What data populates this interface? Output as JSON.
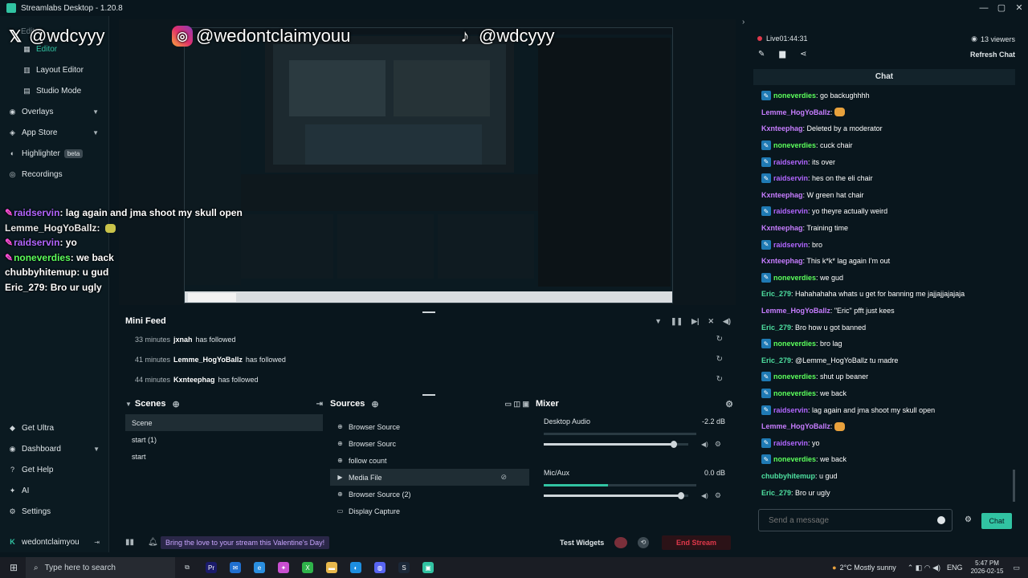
{
  "window": {
    "title": "Streamlabs Desktop - 1.20.8",
    "controls": [
      "—",
      "▢",
      "✕"
    ]
  },
  "sidebar": {
    "top_label": "Editor",
    "items": [
      {
        "label": "Editor",
        "icon": "editor-icon"
      },
      {
        "label": "Layout Editor",
        "icon": "layout-icon"
      },
      {
        "label": "Studio Mode",
        "icon": "studio-icon"
      },
      {
        "label": "Overlays",
        "icon": "overlays-icon",
        "chevron": true
      },
      {
        "label": "App Store",
        "icon": "app-store-icon",
        "chevron": true
      },
      {
        "label": "Highlighter",
        "icon": "highlighter-icon",
        "badge": "beta"
      },
      {
        "label": "Recordings",
        "icon": "recordings-icon"
      }
    ],
    "bottom_items": [
      {
        "label": "Get Ultra",
        "icon": "ultra-icon"
      },
      {
        "label": "Dashboard",
        "icon": "dashboard-icon",
        "chevron": true
      },
      {
        "label": "Get Help",
        "icon": "help-icon"
      },
      {
        "label": "AI",
        "icon": "ai-icon"
      },
      {
        "label": "Settings",
        "icon": "settings-icon"
      }
    ],
    "user": "wedontclaimyou"
  },
  "preview_overlay": {
    "x_handle": "@wdcyyy",
    "ig_handle": "@wedontclaimyouu",
    "tiktok_handle": "@wdcyyy",
    "chat_lines": [
      {
        "user": "raidservin",
        "text": ": lag again and jma shoot my skull open",
        "color": "#b266ff",
        "prime": true
      },
      {
        "user": "Lemme_HogYoBallz",
        "text": ": ",
        "color": "#e8e8e8",
        "emote": true
      },
      {
        "user": "raidservin",
        "text": ": yo",
        "color": "#b266ff",
        "prime": true
      },
      {
        "user": "noneverdies",
        "text": ": we back",
        "color": "#5cff5c",
        "prime": true
      },
      {
        "user": "chubbyhitemup",
        "text": ": u gud",
        "color": "#ffffff"
      },
      {
        "user": "Eric_279",
        "text": ": Bro ur ugly",
        "color": "#ffffff"
      }
    ]
  },
  "mini_feed": {
    "title": "Mini Feed",
    "rows": [
      {
        "time": "33 minutes",
        "name": "jxnah",
        "action": "has followed"
      },
      {
        "time": "41 minutes",
        "name": "Lemme_HogYoBallz",
        "action": "has followed"
      },
      {
        "time": "44 minutes",
        "name": "Kxnteephag",
        "action": "has followed"
      }
    ]
  },
  "scenes": {
    "title": "Scenes",
    "items": [
      "Scene",
      "start (1)",
      "start"
    ],
    "selected": 0
  },
  "sources": {
    "title": "Sources",
    "items": [
      {
        "label": "Browser Source",
        "icon": "globe-icon"
      },
      {
        "label": "Browser Sourc",
        "icon": "globe-icon"
      },
      {
        "label": "follow count",
        "icon": "globe-icon"
      },
      {
        "label": "Media File",
        "icon": "media-icon"
      },
      {
        "label": "Browser Source (2)",
        "icon": "globe-icon"
      },
      {
        "label": "Display Capture",
        "icon": "monitor-icon"
      }
    ],
    "selected": 3
  },
  "mixer": {
    "title": "Mixer",
    "tracks": [
      {
        "name": "Desktop Audio",
        "db": "-2.2 dB",
        "level": 0.9,
        "meter": 0.0
      },
      {
        "name": "Mic/Aux",
        "db": "0.0 dB",
        "level": 0.95,
        "meter": 0.42
      }
    ]
  },
  "bottom_bar": {
    "promo": "Bring the love to your stream this Valentine's Day!",
    "test_widgets": "Test Widgets",
    "end_stream": "End Stream"
  },
  "chat_panel": {
    "live_label": "Live",
    "live_time": "01:44:31",
    "viewers": "13 viewers",
    "refresh": "Refresh Chat",
    "title": "Chat",
    "input_placeholder": "Send a message",
    "send": "Chat",
    "messages": [
      {
        "user": "noneverdies",
        "text": ": go backughhhh",
        "color": "#5cff5c",
        "prime": true
      },
      {
        "user": "Lemme_HogYoBallz",
        "text": ": ",
        "color": "#c77dff",
        "emote": true
      },
      {
        "user": "Kxnteephag",
        "text": ": Deleted by a moderator",
        "color": "#c77dff"
      },
      {
        "user": "noneverdies",
        "text": ": cuck chair",
        "color": "#5cff5c",
        "prime": true
      },
      {
        "user": "raidservin",
        "text": ": its over",
        "color": "#b266ff",
        "prime": true
      },
      {
        "user": "raidservin",
        "text": ": hes on the eli chair",
        "color": "#b266ff",
        "prime": true
      },
      {
        "user": "Kxnteephag",
        "text": ": W green hat chair",
        "color": "#c77dff"
      },
      {
        "user": "raidservin",
        "text": ": yo theyre actually weird",
        "color": "#b266ff",
        "prime": true
      },
      {
        "user": "Kxnteephag",
        "text": ": Training time",
        "color": "#c77dff"
      },
      {
        "user": "raidservin",
        "text": ": bro",
        "color": "#b266ff",
        "prime": true
      },
      {
        "user": "Kxnteephag",
        "text": ": This k*k* lag again I'm out",
        "color": "#c77dff"
      },
      {
        "user": "noneverdies",
        "text": ": we gud",
        "color": "#5cff5c",
        "prime": true
      },
      {
        "user": "Eric_279",
        "text": ": Hahahahaha whats u get for banning me jajjajjajajaja",
        "color": "#4ee0a0"
      },
      {
        "user": "Lemme_HogYoBallz",
        "text": ": \"Eric\" pfft just kees",
        "color": "#c77dff"
      },
      {
        "user": "Eric_279",
        "text": ": Bro how u got banned",
        "color": "#4ee0a0"
      },
      {
        "user": "noneverdies",
        "text": ": bro lag",
        "color": "#5cff5c",
        "prime": true
      },
      {
        "user": "Eric_279",
        "text": ": @Lemme_HogYoBallz tu madre",
        "color": "#4ee0a0"
      },
      {
        "user": "noneverdies",
        "text": ": shut up beaner",
        "color": "#5cff5c",
        "prime": true
      },
      {
        "user": "noneverdies",
        "text": ": we back",
        "color": "#5cff5c",
        "prime": true
      },
      {
        "user": "raidservin",
        "text": ": lag again and jma shoot my skull open",
        "color": "#b266ff",
        "prime": true
      },
      {
        "user": "Lemme_HogYoBallz",
        "text": ": ",
        "color": "#c77dff",
        "emote": true
      },
      {
        "user": "raidservin",
        "text": ": yo",
        "color": "#b266ff",
        "prime": true
      },
      {
        "user": "noneverdies",
        "text": ": we back",
        "color": "#5cff5c",
        "prime": true
      },
      {
        "user": "chubbyhitemup",
        "text": ": u gud",
        "color": "#4ee0a0"
      },
      {
        "user": "Eric_279",
        "text": ": Bro ur ugly",
        "color": "#4ee0a0"
      }
    ]
  },
  "taskbar": {
    "search_placeholder": "Type here to search",
    "weather": "2°C  Mostly sunny",
    "lang": "ENG",
    "time": "5:47 PM",
    "date": "2026-02-15"
  },
  "colors": {
    "accent": "#31c3a2",
    "end_stream": "#e0384b",
    "live_dot": "#e0384b"
  }
}
